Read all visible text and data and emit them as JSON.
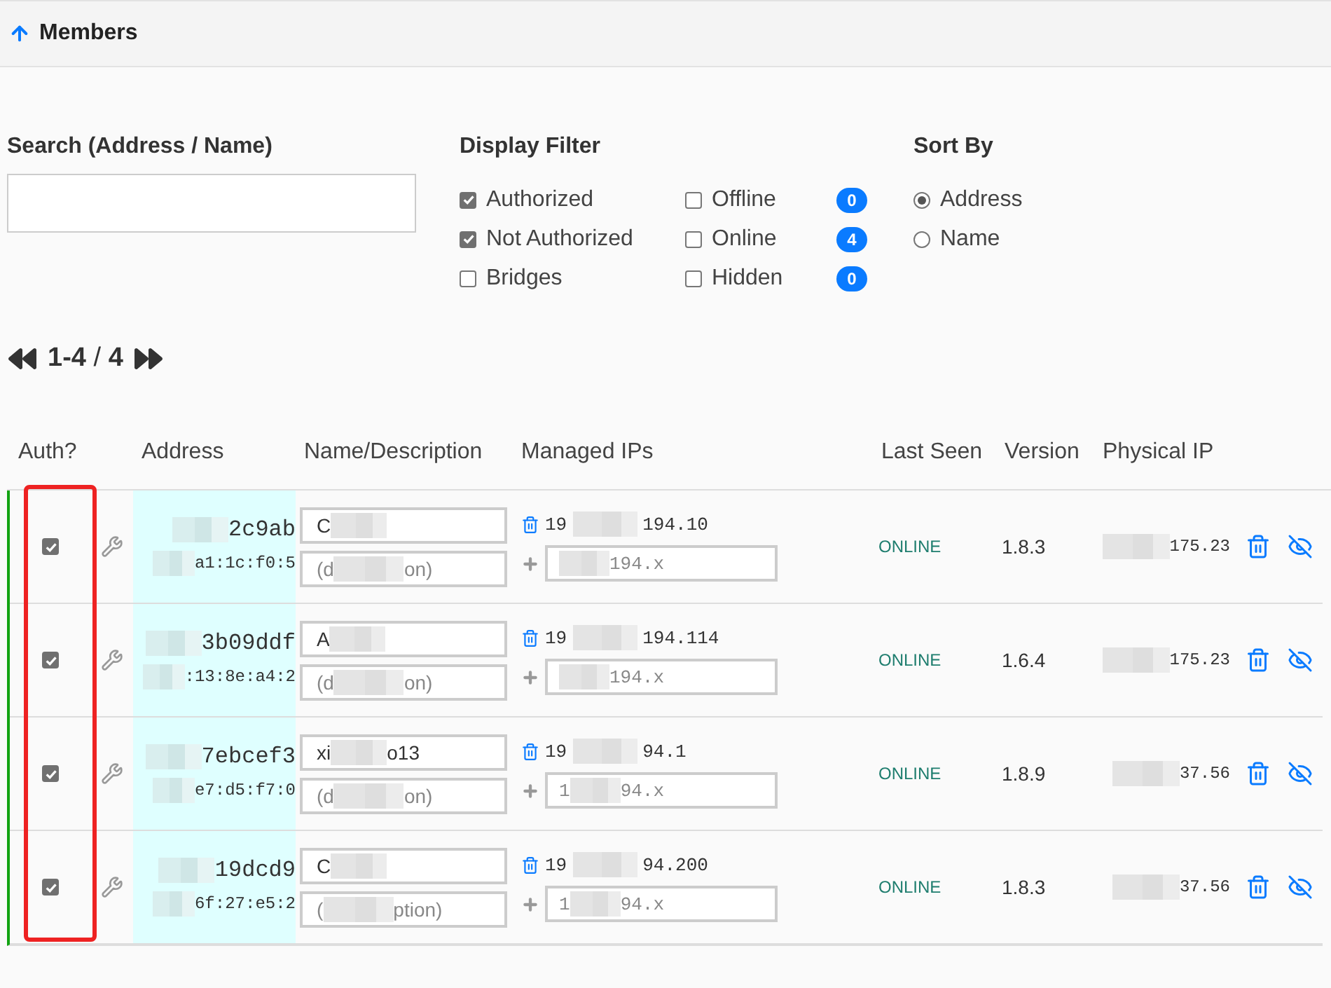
{
  "header": {
    "title": "Members"
  },
  "search": {
    "label": "Search (Address / Name)"
  },
  "display_filter": {
    "title": "Display Filter",
    "items": [
      {
        "label": "Authorized",
        "checked": true
      },
      {
        "label": "Offline",
        "checked": false,
        "count": "0"
      },
      {
        "label": "Not Authorized",
        "checked": true
      },
      {
        "label": "Online",
        "checked": false,
        "count": "4"
      },
      {
        "label": "Bridges",
        "checked": false
      },
      {
        "label": "Hidden",
        "checked": false,
        "count": "0"
      }
    ]
  },
  "sort_by": {
    "title": "Sort By",
    "options": [
      {
        "label": "Address",
        "selected": true
      },
      {
        "label": "Name",
        "selected": false
      }
    ]
  },
  "pagination": {
    "range": "1-4",
    "separator": "/",
    "total": "4"
  },
  "table": {
    "columns": [
      "Auth?",
      "Address",
      "Name/Description",
      "Managed IPs",
      "Last Seen",
      "Version",
      "Physical IP"
    ],
    "rows": [
      {
        "authorized": true,
        "address": {
          "after": "2c9ab"
        },
        "mac": {
          "after": "a1:1c:f0:5"
        },
        "name": {
          "before": "C"
        },
        "description": {
          "before": "(d",
          "after": "on)"
        },
        "ip": {
          "before": "19",
          "after": "194.10"
        },
        "add_ip": {
          "after": "194.x"
        },
        "last_seen": "ONLINE",
        "version": "1.8.3",
        "physical_ip": {
          "after": "175.23"
        }
      },
      {
        "authorized": true,
        "address": {
          "after": "3b09ddf"
        },
        "mac": {
          "after": ":13:8e:a4:2"
        },
        "name": {
          "before": "A"
        },
        "description": {
          "before": "(d",
          "after": "on)"
        },
        "ip": {
          "before": "19",
          "after": "194.114"
        },
        "add_ip": {
          "after": "194.x"
        },
        "last_seen": "ONLINE",
        "version": "1.6.4",
        "physical_ip": {
          "after": "175.23"
        }
      },
      {
        "authorized": true,
        "address": {
          "after": "7ebcef3"
        },
        "mac": {
          "after": "e7:d5:f7:0"
        },
        "name": {
          "before": "xi",
          "after": "o13"
        },
        "description": {
          "before": "(d",
          "after": "on)"
        },
        "ip": {
          "before": "19",
          "after": "94.1"
        },
        "add_ip": {
          "before": "1",
          "after": "94.x"
        },
        "last_seen": "ONLINE",
        "version": "1.8.9",
        "physical_ip": {
          "after": "37.56"
        }
      },
      {
        "authorized": true,
        "address": {
          "after": "19dcd9"
        },
        "mac": {
          "after": "6f:27:e5:2"
        },
        "name": {
          "before": "C"
        },
        "description": {
          "before": "(",
          "after": "ption)"
        },
        "ip": {
          "before": "19",
          "after": "94.200"
        },
        "add_ip": {
          "before": "1",
          "after": "94.x"
        },
        "last_seen": "ONLINE",
        "version": "1.8.3",
        "physical_ip": {
          "after": "37.56"
        }
      }
    ]
  }
}
